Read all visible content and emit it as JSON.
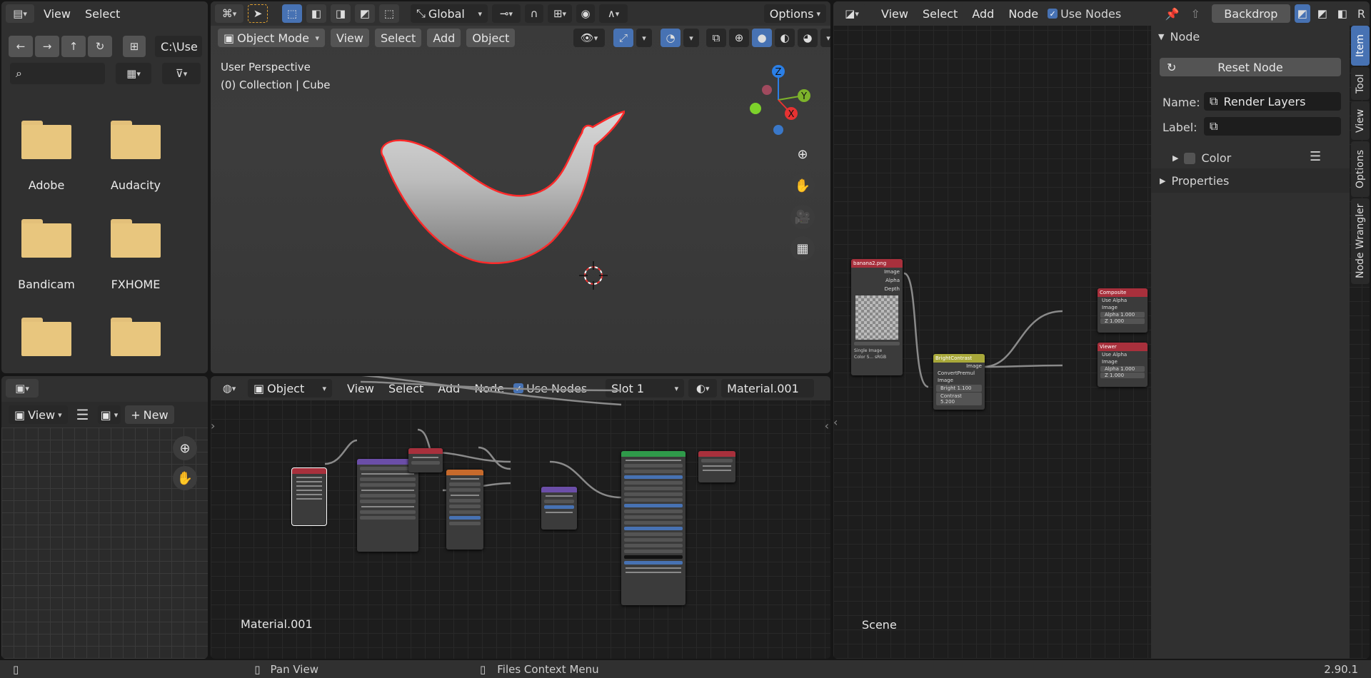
{
  "file_browser": {
    "menus": [
      "View",
      "Select"
    ],
    "path": "C:\\Use",
    "search_placeholder": "",
    "folders": [
      "Adobe",
      "Audacity",
      "Bandicam",
      "FXHOME",
      "",
      ""
    ]
  },
  "image_editor": {
    "view": "View",
    "new": "New"
  },
  "viewport": {
    "transform": "Global",
    "options": "Options",
    "mode": "Object Mode",
    "menus": [
      "View",
      "Select",
      "Add",
      "Object"
    ],
    "perspective": "User Perspective",
    "collection": "(0) Collection | Cube",
    "gizmo": {
      "z": "Z",
      "y": "Y",
      "x": "X"
    }
  },
  "shader_editor": {
    "type": "Object",
    "menus": [
      "View",
      "Select",
      "Add",
      "Node"
    ],
    "use_nodes": "Use Nodes",
    "slot": "Slot 1",
    "material": "Material.001",
    "footer_label": "Material.001"
  },
  "compositor": {
    "menus": [
      "View",
      "Select",
      "Add",
      "Node"
    ],
    "use_nodes": "Use Nodes",
    "backdrop": "Backdrop",
    "r": "R",
    "scene_label": "Scene",
    "nodes": {
      "image": {
        "title": "banana2.png",
        "outputs": [
          "Image",
          "Alpha",
          "Depth"
        ],
        "footer": [
          "Single Image",
          "Color S... sRGB"
        ]
      },
      "bright": {
        "title": "BrightContrast",
        "out": "Image",
        "rows": [
          "ConvertPremul",
          "Image",
          "Bright 1.100",
          "Contrast 5.200"
        ]
      },
      "composite": {
        "title": "Composite",
        "rows": [
          "Use Alpha",
          "Image",
          "Alpha 1.000",
          "Z 1.000"
        ]
      },
      "viewer": {
        "title": "Viewer",
        "rows": [
          "Use Alpha",
          "Image",
          "Alpha 1.000",
          "Z 1.000"
        ]
      }
    }
  },
  "sidebar": {
    "panel_node": "Node",
    "reset_node": "Reset Node",
    "name_label": "Name:",
    "name_value": "Render Layers",
    "label_label": "Label:",
    "label_value": "",
    "color": "Color",
    "properties": "Properties",
    "tabs": [
      "Item",
      "Tool",
      "View",
      "Options",
      "Node Wrangler"
    ]
  },
  "status": {
    "pan": "Pan View",
    "context": "Files Context Menu",
    "version": "2.90.1"
  }
}
